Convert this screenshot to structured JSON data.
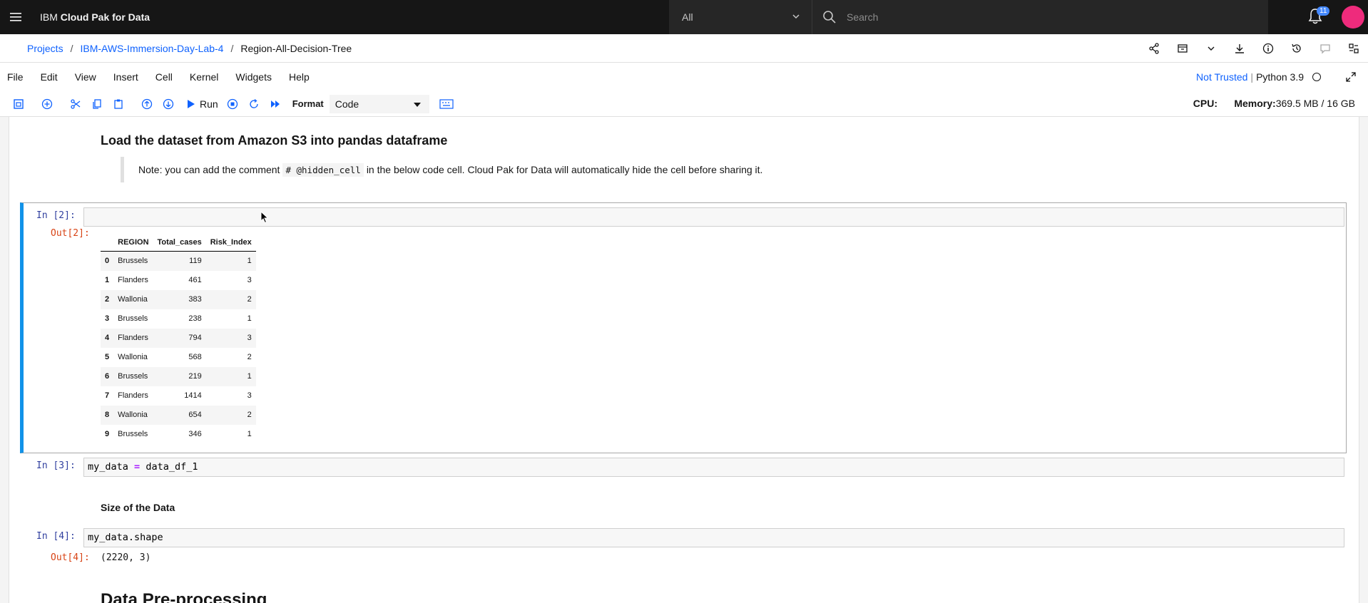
{
  "header": {
    "brand_prefix": "IBM",
    "brand_name": "Cloud Pak for Data",
    "scope": "All",
    "search_placeholder": "Search",
    "notification_count": "11"
  },
  "breadcrumb": {
    "items": [
      "Projects",
      "IBM-AWS-Immersion-Day-Lab-4"
    ],
    "separator": "/",
    "current": "Region-All-Decision-Tree"
  },
  "menu": {
    "items": [
      "File",
      "Edit",
      "View",
      "Insert",
      "Cell",
      "Kernel",
      "Widgets",
      "Help"
    ],
    "trust": "Not Trusted",
    "kernel_sep": "|",
    "kernel": "Python 3.9"
  },
  "toolbar": {
    "run_label": "Run",
    "format_label": "Format",
    "format_value": "Code",
    "cpu_label": "CPU:",
    "memory_label": "Memory:",
    "memory_value": "369.5 MB / 16 GB"
  },
  "notebook": {
    "md_heading": "Load the dataset from Amazon S3 into pandas dataframe",
    "note_prefix": "Note: you can add the comment",
    "note_code": "# @hidden_cell",
    "note_suffix": "in the below code cell. Cloud Pak for Data will automatically hide the cell before sharing it.",
    "cell2": {
      "in_prompt": "In [2]:",
      "out_prompt": "Out[2]:",
      "columns": [
        "",
        "REGION",
        "Total_cases",
        "Risk_Index"
      ],
      "rows": [
        [
          "0",
          "Brussels",
          "119",
          "1"
        ],
        [
          "1",
          "Flanders",
          "461",
          "3"
        ],
        [
          "2",
          "Wallonia",
          "383",
          "2"
        ],
        [
          "3",
          "Brussels",
          "238",
          "1"
        ],
        [
          "4",
          "Flanders",
          "794",
          "3"
        ],
        [
          "5",
          "Wallonia",
          "568",
          "2"
        ],
        [
          "6",
          "Brussels",
          "219",
          "1"
        ],
        [
          "7",
          "Flanders",
          "1414",
          "3"
        ],
        [
          "8",
          "Wallonia",
          "654",
          "2"
        ],
        [
          "9",
          "Brussels",
          "346",
          "1"
        ]
      ]
    },
    "cell3": {
      "in_prompt": "In [3]:",
      "code_lhs": "my_data",
      "code_op": "=",
      "code_rhs": "data_df_1"
    },
    "subheading": "Size of the Data",
    "cell4": {
      "in_prompt": "In [4]:",
      "code": "my_data.shape",
      "out_prompt": "Out[4]:",
      "output": "(2220, 3)"
    },
    "next_heading": "Data Pre-processing"
  }
}
